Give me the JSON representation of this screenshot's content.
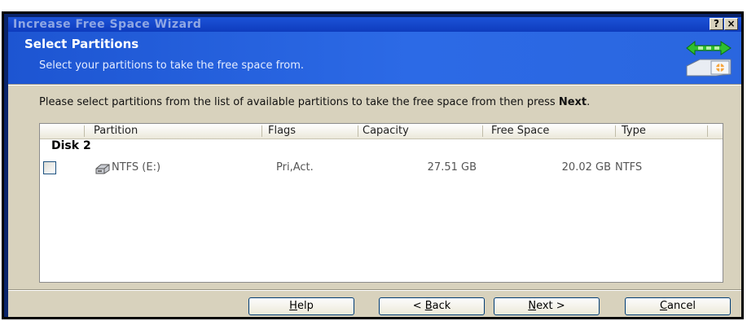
{
  "window": {
    "title": "Increase Free Space Wizard",
    "help_glyph": "?",
    "close_glyph": "×"
  },
  "header": {
    "title": "Select Partitions",
    "subtitle": "Select your partitions to take the free space from."
  },
  "instructions": {
    "text": "Please select partitions from the list of available partitions to take the free space from then press ",
    "emphasis": "Next",
    "suffix": "."
  },
  "table": {
    "columns": [
      "Partition",
      "Flags",
      "Capacity",
      "Free Space",
      "Type"
    ],
    "group_label": "Disk 2",
    "rows": [
      {
        "checked": false,
        "partition": "NTFS (E:)",
        "flags": "Pri,Act.",
        "capacity": "27.51 GB",
        "free_space": "20.02 GB",
        "type": "NTFS"
      }
    ]
  },
  "buttons": {
    "help": {
      "access": "H",
      "rest": "elp"
    },
    "back": {
      "prefix": "< ",
      "access": "B",
      "rest": "ack"
    },
    "next": {
      "access": "N",
      "rest": "ext >"
    },
    "cancel": {
      "access": "C",
      "rest": "ancel"
    }
  },
  "icons": {
    "header_icon": "disk-transfer-icon",
    "partition_icon": "drive-icon"
  },
  "colors": {
    "header_bg": "#2a62dc",
    "title_bar": "#1c53d8",
    "dialog_bg": "#d8d2bd"
  }
}
